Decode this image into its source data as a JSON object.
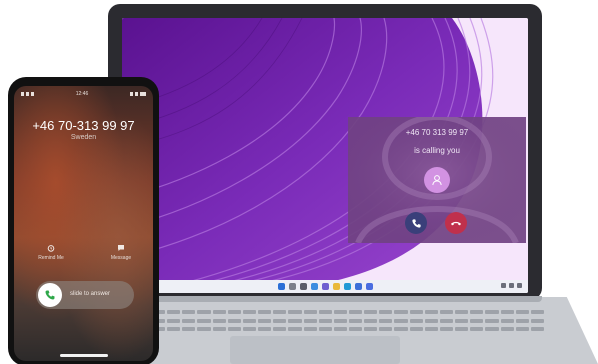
{
  "phone": {
    "status_time": "12:46",
    "caller_number": "+46 70-313 99 97",
    "caller_country": "Sweden",
    "remind_label": "Remind Me",
    "message_label": "Message",
    "slide_label": "slide to answer",
    "icons": {
      "remind": "alarm-icon",
      "message": "message-bubble-icon",
      "answer": "phone-handset-icon"
    }
  },
  "laptop": {
    "popup": {
      "number": "+46 70 313 99 97",
      "status": "is calling you",
      "icons": {
        "avatar": "person-icon",
        "accept": "phone-accept-icon",
        "decline": "phone-decline-icon"
      }
    }
  },
  "colors": {
    "wallpaper_purple": "#6a1aa0",
    "popup_bg": "#704282",
    "accept": "#3a3f7a",
    "decline": "#c0304c",
    "avatar": "#d292e2",
    "answer_green": "#2fa84a"
  }
}
